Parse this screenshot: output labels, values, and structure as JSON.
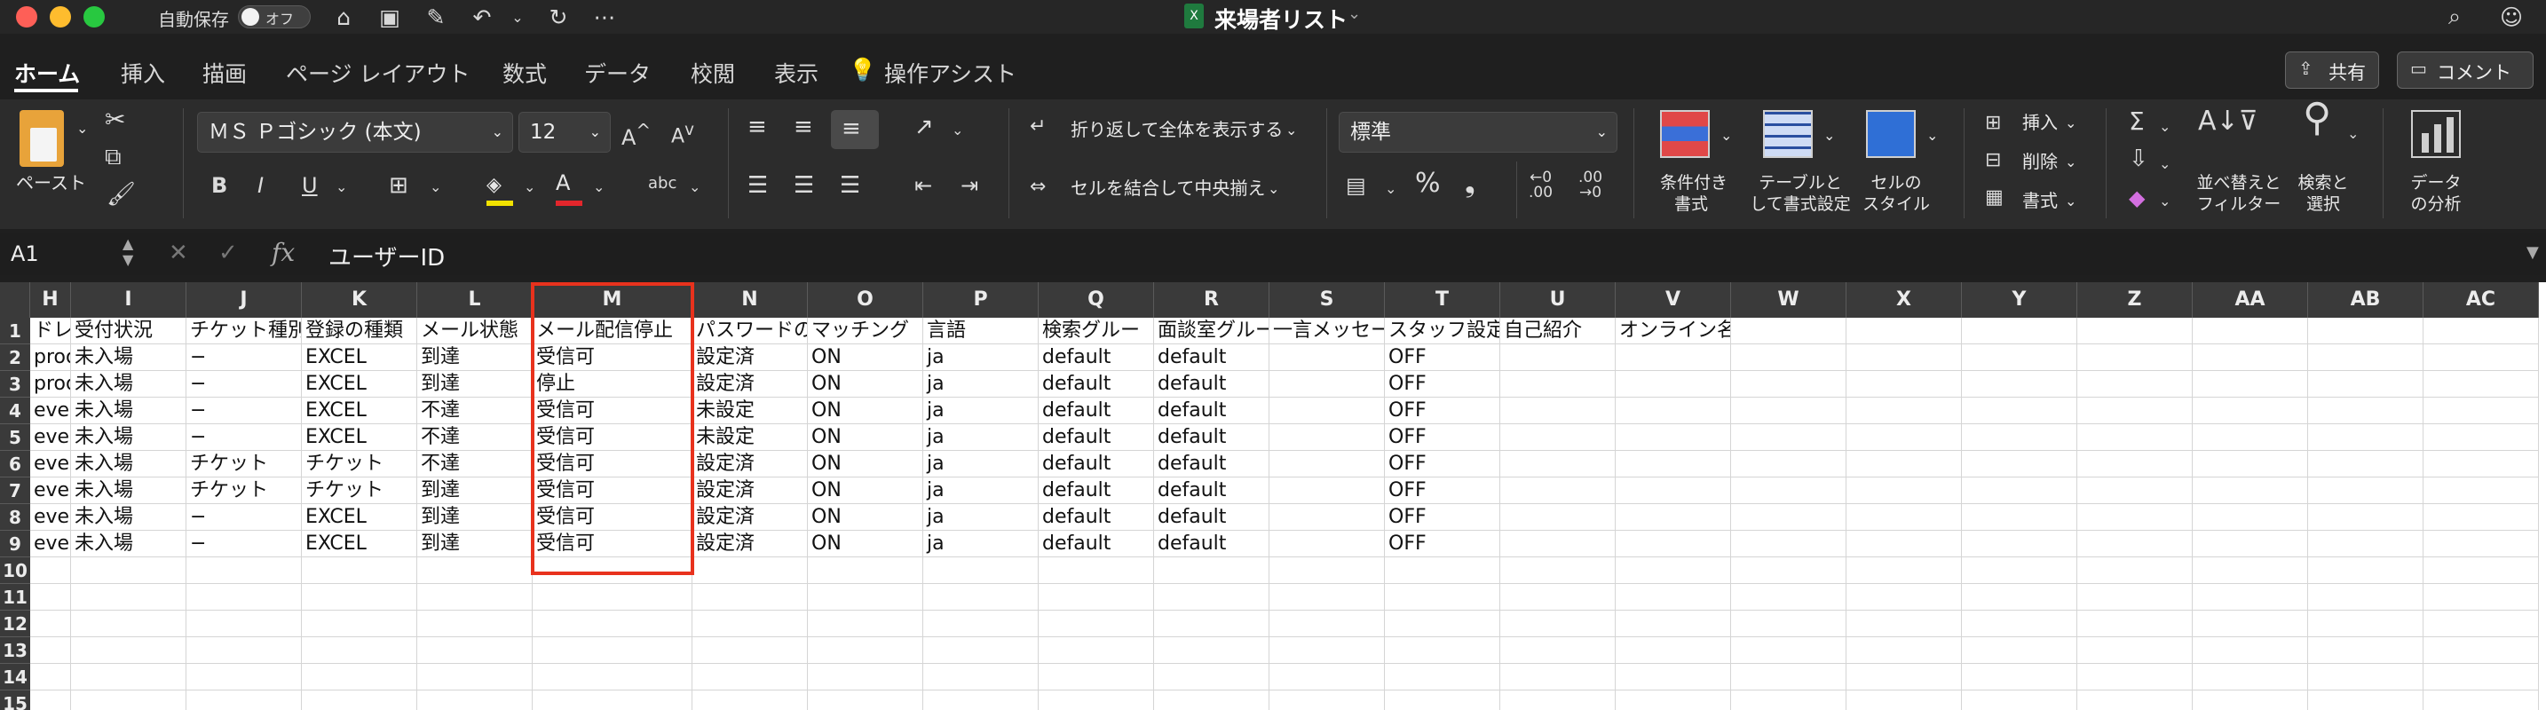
{
  "app": {
    "title": "来場者リスト",
    "autosave_label": "自動保存",
    "autosave_state": "オフ"
  },
  "tabs": [
    "ホーム",
    "挿入",
    "描画",
    "ページ レイアウト",
    "数式",
    "データ",
    "校閲",
    "表示",
    "操作アシスト"
  ],
  "share": {
    "share_label": "共有",
    "comment_label": "コメント"
  },
  "ribbon": {
    "paste_label": "ペースト",
    "font_name": "ＭＳ Ｐゴシック (本文)",
    "font_size": "12",
    "wrap_text": "折り返して全体を表示する",
    "merge_center": "セルを結合して中央揃え",
    "number_format": "標準",
    "cond_format": [
      "条件付き",
      "書式"
    ],
    "format_table": [
      "テーブルと",
      "して書式設定"
    ],
    "cell_styles": [
      "セルの",
      "スタイル"
    ],
    "insert_label": "挿入",
    "delete_label": "削除",
    "format_label": "書式",
    "sort_filter": [
      "並べ替えと",
      "フィルター"
    ],
    "find_select": [
      "検索と",
      "選択"
    ],
    "analyze": [
      "データ",
      "の分析"
    ]
  },
  "formula_bar": {
    "name_box": "A1",
    "fx": "fx",
    "content": "ユーザーID"
  },
  "columns": [
    {
      "id": "H",
      "w": 46
    },
    {
      "id": "I",
      "w": 130
    },
    {
      "id": "J",
      "w": 130
    },
    {
      "id": "K",
      "w": 130
    },
    {
      "id": "L",
      "w": 130
    },
    {
      "id": "M",
      "w": 180
    },
    {
      "id": "N",
      "w": 130
    },
    {
      "id": "O",
      "w": 130
    },
    {
      "id": "P",
      "w": 130
    },
    {
      "id": "Q",
      "w": 130
    },
    {
      "id": "R",
      "w": 130
    },
    {
      "id": "S",
      "w": 130
    },
    {
      "id": "T",
      "w": 130
    },
    {
      "id": "U",
      "w": 130
    },
    {
      "id": "V",
      "w": 130
    },
    {
      "id": "W",
      "w": 130
    },
    {
      "id": "X",
      "w": 130
    },
    {
      "id": "Y",
      "w": 130
    },
    {
      "id": "Z",
      "w": 130
    },
    {
      "id": "AA",
      "w": 130
    },
    {
      "id": "AB",
      "w": 130
    },
    {
      "id": "AC",
      "w": 130
    }
  ],
  "rows": [
    [
      "ドレ",
      "受付状況",
      "チケット種別",
      "登録の種類",
      "メール状態",
      "メール配信停止",
      "パスワードの",
      "マッチング",
      "言語",
      "検索グルー",
      "面談室グルー",
      "一言メッセー",
      "スタッフ設定",
      "自己紹介",
      "オンライン名刺URL",
      "",
      "",
      "",
      "",
      "",
      "",
      ""
    ],
    [
      "prool",
      "未入場",
      "−",
      "EXCEL",
      "到達",
      "受信可",
      "設定済",
      "ON",
      "ja",
      "default",
      "default",
      "",
      "OFF",
      "",
      "",
      "",
      "",
      "",
      "",
      "",
      "",
      ""
    ],
    [
      "prool",
      "未入場",
      "−",
      "EXCEL",
      "到達",
      "停止",
      "設定済",
      "ON",
      "ja",
      "default",
      "default",
      "",
      "OFF",
      "",
      "",
      "",
      "",
      "",
      "",
      "",
      "",
      ""
    ],
    [
      "ever",
      "未入場",
      "−",
      "EXCEL",
      "不達",
      "受信可",
      "未設定",
      "ON",
      "ja",
      "default",
      "default",
      "",
      "OFF",
      "",
      "",
      "",
      "",
      "",
      "",
      "",
      "",
      ""
    ],
    [
      "ever",
      "未入場",
      "−",
      "EXCEL",
      "不達",
      "受信可",
      "未設定",
      "ON",
      "ja",
      "default",
      "default",
      "",
      "OFF",
      "",
      "",
      "",
      "",
      "",
      "",
      "",
      "",
      ""
    ],
    [
      "ever",
      "未入場",
      "チケット",
      "チケット",
      "不達",
      "受信可",
      "設定済",
      "ON",
      "ja",
      "default",
      "default",
      "",
      "OFF",
      "",
      "",
      "",
      "",
      "",
      "",
      "",
      "",
      ""
    ],
    [
      "ever",
      "未入場",
      "チケット",
      "チケット",
      "到達",
      "受信可",
      "設定済",
      "ON",
      "ja",
      "default",
      "default",
      "",
      "OFF",
      "",
      "",
      "",
      "",
      "",
      "",
      "",
      "",
      ""
    ],
    [
      "ever",
      "未入場",
      "−",
      "EXCEL",
      "到達",
      "受信可",
      "設定済",
      "ON",
      "ja",
      "default",
      "default",
      "",
      "OFF",
      "",
      "",
      "",
      "",
      "",
      "",
      "",
      "",
      ""
    ],
    [
      "ever",
      "未入場",
      "−",
      "EXCEL",
      "到達",
      "受信可",
      "設定済",
      "ON",
      "ja",
      "default",
      "default",
      "",
      "OFF",
      "",
      "",
      "",
      "",
      "",
      "",
      "",
      "",
      ""
    ],
    [
      "",
      "",
      "",
      "",
      "",
      "",
      "",
      "",
      "",
      "",
      "",
      "",
      "",
      "",
      "",
      "",
      "",
      "",
      "",
      "",
      "",
      ""
    ],
    [
      "",
      "",
      "",
      "",
      "",
      "",
      "",
      "",
      "",
      "",
      "",
      "",
      "",
      "",
      "",
      "",
      "",
      "",
      "",
      "",
      "",
      ""
    ],
    [
      "",
      "",
      "",
      "",
      "",
      "",
      "",
      "",
      "",
      "",
      "",
      "",
      "",
      "",
      "",
      "",
      "",
      "",
      "",
      "",
      "",
      ""
    ],
    [
      "",
      "",
      "",
      "",
      "",
      "",
      "",
      "",
      "",
      "",
      "",
      "",
      "",
      "",
      "",
      "",
      "",
      "",
      "",
      "",
      "",
      ""
    ],
    [
      "",
      "",
      "",
      "",
      "",
      "",
      "",
      "",
      "",
      "",
      "",
      "",
      "",
      "",
      "",
      "",
      "",
      "",
      "",
      "",
      "",
      ""
    ],
    [
      "",
      "",
      "",
      "",
      "",
      "",
      "",
      "",
      "",
      "",
      "",
      "",
      "",
      "",
      "",
      "",
      "",
      "",
      "",
      "",
      "",
      ""
    ]
  ],
  "row_numbers": [
    "1",
    "2",
    "3",
    "4",
    "5",
    "6",
    "7",
    "8",
    "9",
    "10",
    "11",
    "12",
    "13",
    "14",
    "15"
  ],
  "highlight_color": "#e8321d"
}
